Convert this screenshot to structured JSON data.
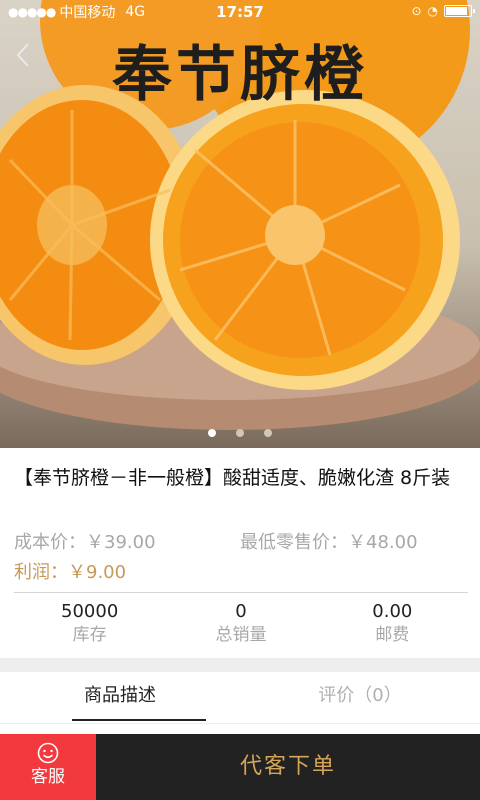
{
  "status_bar": {
    "signal": "●●●●●",
    "carrier": "中国移动",
    "network": "4G",
    "time": "17:57"
  },
  "hero": {
    "title": "奉节脐橙",
    "images_count": 3,
    "active_index": 0
  },
  "product": {
    "title": "【奉节脐橙－非一般橙】酸甜适度、脆嫩化渣 8斤装",
    "cost_label": "成本价：",
    "cost_value": "￥39.00",
    "min_retail_label": "最低零售价：",
    "min_retail_value": "￥48.00",
    "profit_label": "利润：",
    "profit_value": "￥9.00"
  },
  "stats": [
    {
      "value": "50000",
      "label": "库存"
    },
    {
      "value": "0",
      "label": "总销量"
    },
    {
      "value": "0.00",
      "label": "邮费"
    }
  ],
  "tabs": [
    {
      "label": "商品描述",
      "active": true
    },
    {
      "label": "评价（0）",
      "active": false
    }
  ],
  "bottom_bar": {
    "service_label": "客服",
    "order_label": "代客下单"
  },
  "colors": {
    "accent_red": "#f23a3e",
    "gold": "#d5a559",
    "profit": "#c7995a",
    "dark": "#222222"
  }
}
